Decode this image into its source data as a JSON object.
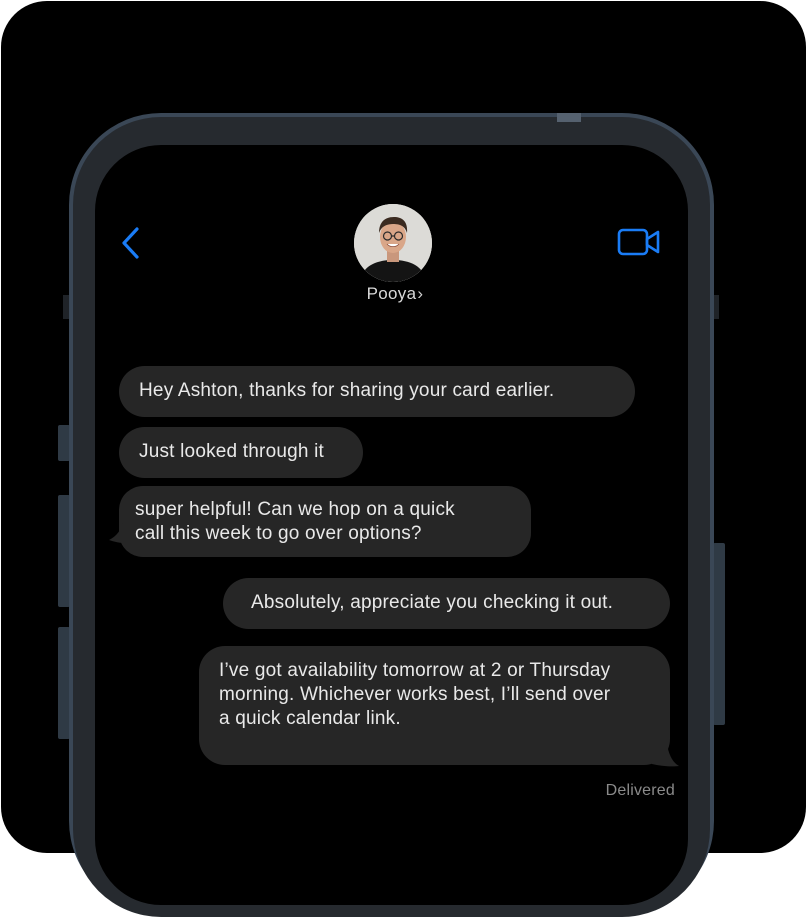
{
  "header": {
    "contact_name": "Pooya",
    "chevron": "›",
    "back_icon": "chevron-left-icon",
    "video_icon": "video-camera-icon",
    "accent_color": "#1a7cf5"
  },
  "messages": [
    {
      "direction": "incoming",
      "text": "Hey Ashton, thanks for sharing your card earlier."
    },
    {
      "direction": "incoming",
      "text": "Just looked through it"
    },
    {
      "direction": "incoming",
      "lines": [
        "super helpful! Can we hop on a quick",
        "call this week to go over options?"
      ]
    },
    {
      "direction": "outgoing",
      "text": "Absolutely, appreciate you checking it out."
    },
    {
      "direction": "outgoing",
      "lines": [
        "I’ve got availability tomorrow at 2 or Thursday",
        "morning. Whichever works best, I’ll send over",
        "a quick calendar link."
      ]
    }
  ],
  "status": {
    "delivered": "Delivered"
  }
}
